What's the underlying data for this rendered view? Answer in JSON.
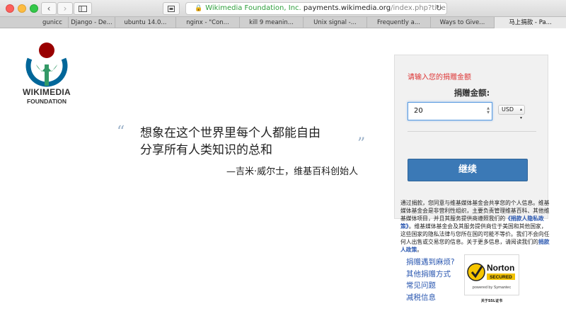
{
  "browser": {
    "url_org": "Wikimedia Foundation, Inc.",
    "url_host": "payments.wikimedia.org",
    "url_path": "/index.php?title=Special",
    "tabs": [
      {
        "label": "gunicc"
      },
      {
        "label": "Django - De..."
      },
      {
        "label": "ubuntu 14.0..."
      },
      {
        "label": "nginx - \"Con..."
      },
      {
        "label": "kill 9 meanin..."
      },
      {
        "label": "Unix signal -..."
      },
      {
        "label": "Frequently a..."
      },
      {
        "label": "Ways to Give..."
      },
      {
        "label": "马上捐款 - Pa..."
      }
    ]
  },
  "logo": {
    "line1": "WIKIMEDIA",
    "line2": "FOUNDATION",
    "colors": {
      "red": "#990000",
      "green": "#339966",
      "blue": "#006699"
    }
  },
  "quote": {
    "open_mark": "“",
    "close_mark": "”",
    "line1": "想象在这个世界里每个人都能自由",
    "line2": "分享所有人类知识的总和",
    "author": "—吉米·威尔士，维基百科创始人"
  },
  "donation": {
    "prompt": "请输入您的捐赠金额",
    "amount_label": "捐赠金额:",
    "amount_value": "20",
    "currency": "USD",
    "continue_label": "继续"
  },
  "privacy": {
    "text1": "通过捐款，您同意与维基媒体基金会共享您的个人信息。维基媒体基金会是非营利性组织，主要负责管理维基百科、其他维基媒体项目，并且其服务提供商遵照我们的",
    "link1": "《捐款人隐私政策》",
    "text2": "。维基媒体基金会及其服务提供商位于美国和其他国家，这些国家的隐私法律与您所在国的可能不等价。我们不会向任何人出售或交易您的信息。关于更多信息，请阅读我们的",
    "link2": "捐款人政策",
    "text3": "。"
  },
  "help_links": [
    {
      "label": "捐赠遇到麻烦?"
    },
    {
      "label": "其他捐赠方式"
    },
    {
      "label": "常见问题"
    },
    {
      "label": "减税信息"
    }
  ],
  "norton": {
    "brand": "Norton",
    "secured": "SECURED",
    "powered": "powered by Symantec",
    "ssl_label": "关于SSL证书"
  }
}
